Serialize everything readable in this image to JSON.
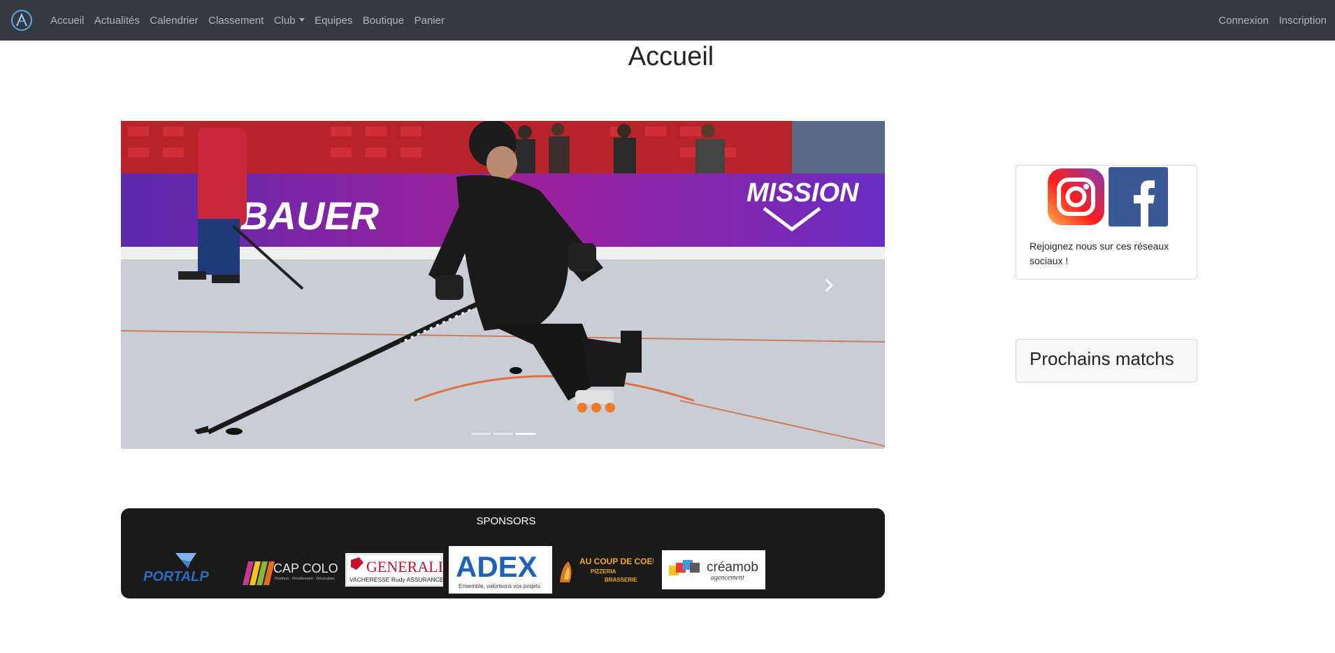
{
  "navbar": {
    "brand_icon": "club-logo-icon",
    "links": [
      "Accueil",
      "Actualités",
      "Calendrier",
      "Classement",
      "Club",
      "Equipes",
      "Boutique",
      "Panier"
    ],
    "right_links": [
      "Connexion",
      "Inscription"
    ],
    "background": "#343a40"
  },
  "page": {
    "title": "Accueil"
  },
  "carousel": {
    "slides_count": 3,
    "active_index": 2,
    "banner_texts": [
      "BAUER",
      "MISSION"
    ],
    "next_icon": "chevron-right-icon"
  },
  "sponsors": {
    "title": "SPONSORS",
    "logos": {
      "portalp": "PORTALP",
      "capcolor": {
        "name": "CAP COLOR",
        "tagline": "Peinture . Revêtement . Décoration"
      },
      "generali": {
        "name": "GENERALI",
        "sub": "VACHERESSE Rudy ASSURANCES"
      },
      "adex": {
        "name": "ADEX",
        "sub": "Ensemble, valorisons vos projets"
      },
      "coupdecoeur": {
        "name": "AU COUP DE COEUR",
        "sub1": "PIZZERIA",
        "sub2": "BRASSERIE"
      },
      "creamob": {
        "name": "créamob",
        "sub": "agencement"
      }
    }
  },
  "social": {
    "icons": [
      "instagram-icon",
      "facebook-icon"
    ],
    "text": "Rejoignez nous sur ces réseaux sociaux !"
  },
  "matches": {
    "title": "Prochains matchs"
  }
}
